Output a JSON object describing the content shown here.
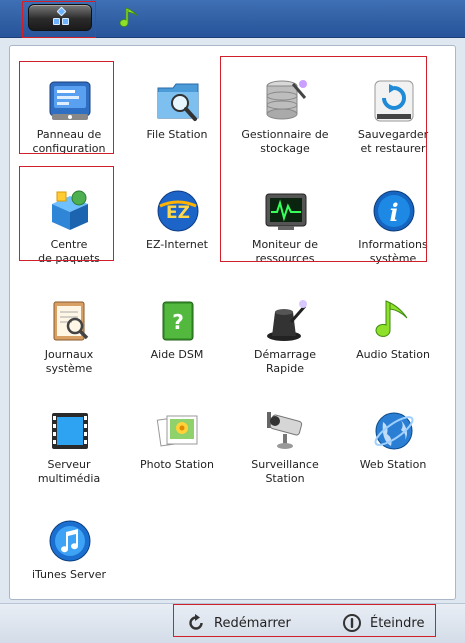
{
  "taskbar": {
    "main_menu_icon": "main-menu-grid-icon",
    "pinned_app_icon": "music-note-icon"
  },
  "apps": [
    {
      "label": "Panneau de\nconfiguration",
      "icon": "control-panel-icon"
    },
    {
      "label": "File Station",
      "icon": "folder-search-icon"
    },
    {
      "label": "Gestionnaire de\nstockage",
      "icon": "storage-manager-icon"
    },
    {
      "label": "Sauvegarder\net restaurer",
      "icon": "backup-restore-icon"
    },
    {
      "label": "Centre\nde paquets",
      "icon": "package-center-icon"
    },
    {
      "label": "EZ-Internet",
      "icon": "ez-internet-icon"
    },
    {
      "label": "Moniteur de\nressources",
      "icon": "resource-monitor-icon"
    },
    {
      "label": "Informations\nsystème",
      "icon": "system-info-icon"
    },
    {
      "label": "Journaux\nsystème",
      "icon": "system-log-icon"
    },
    {
      "label": "Aide DSM",
      "icon": "dsm-help-icon"
    },
    {
      "label": "Démarrage\nRapide",
      "icon": "quick-start-icon"
    },
    {
      "label": "Audio Station",
      "icon": "audio-station-icon"
    },
    {
      "label": "Serveur\nmultimédia",
      "icon": "media-server-icon"
    },
    {
      "label": "Photo Station",
      "icon": "photo-station-icon"
    },
    {
      "label": "Surveillance\nStation",
      "icon": "surveillance-camera-icon"
    },
    {
      "label": "Web Station",
      "icon": "web-station-icon"
    },
    {
      "label": "iTunes Server",
      "icon": "itunes-server-icon"
    }
  ],
  "footer": {
    "restart_label": "Redémarrer",
    "shutdown_label": "Éteindre"
  },
  "colors": {
    "highlight_border": "#d0202a",
    "topbar": "#2f5ea6"
  }
}
